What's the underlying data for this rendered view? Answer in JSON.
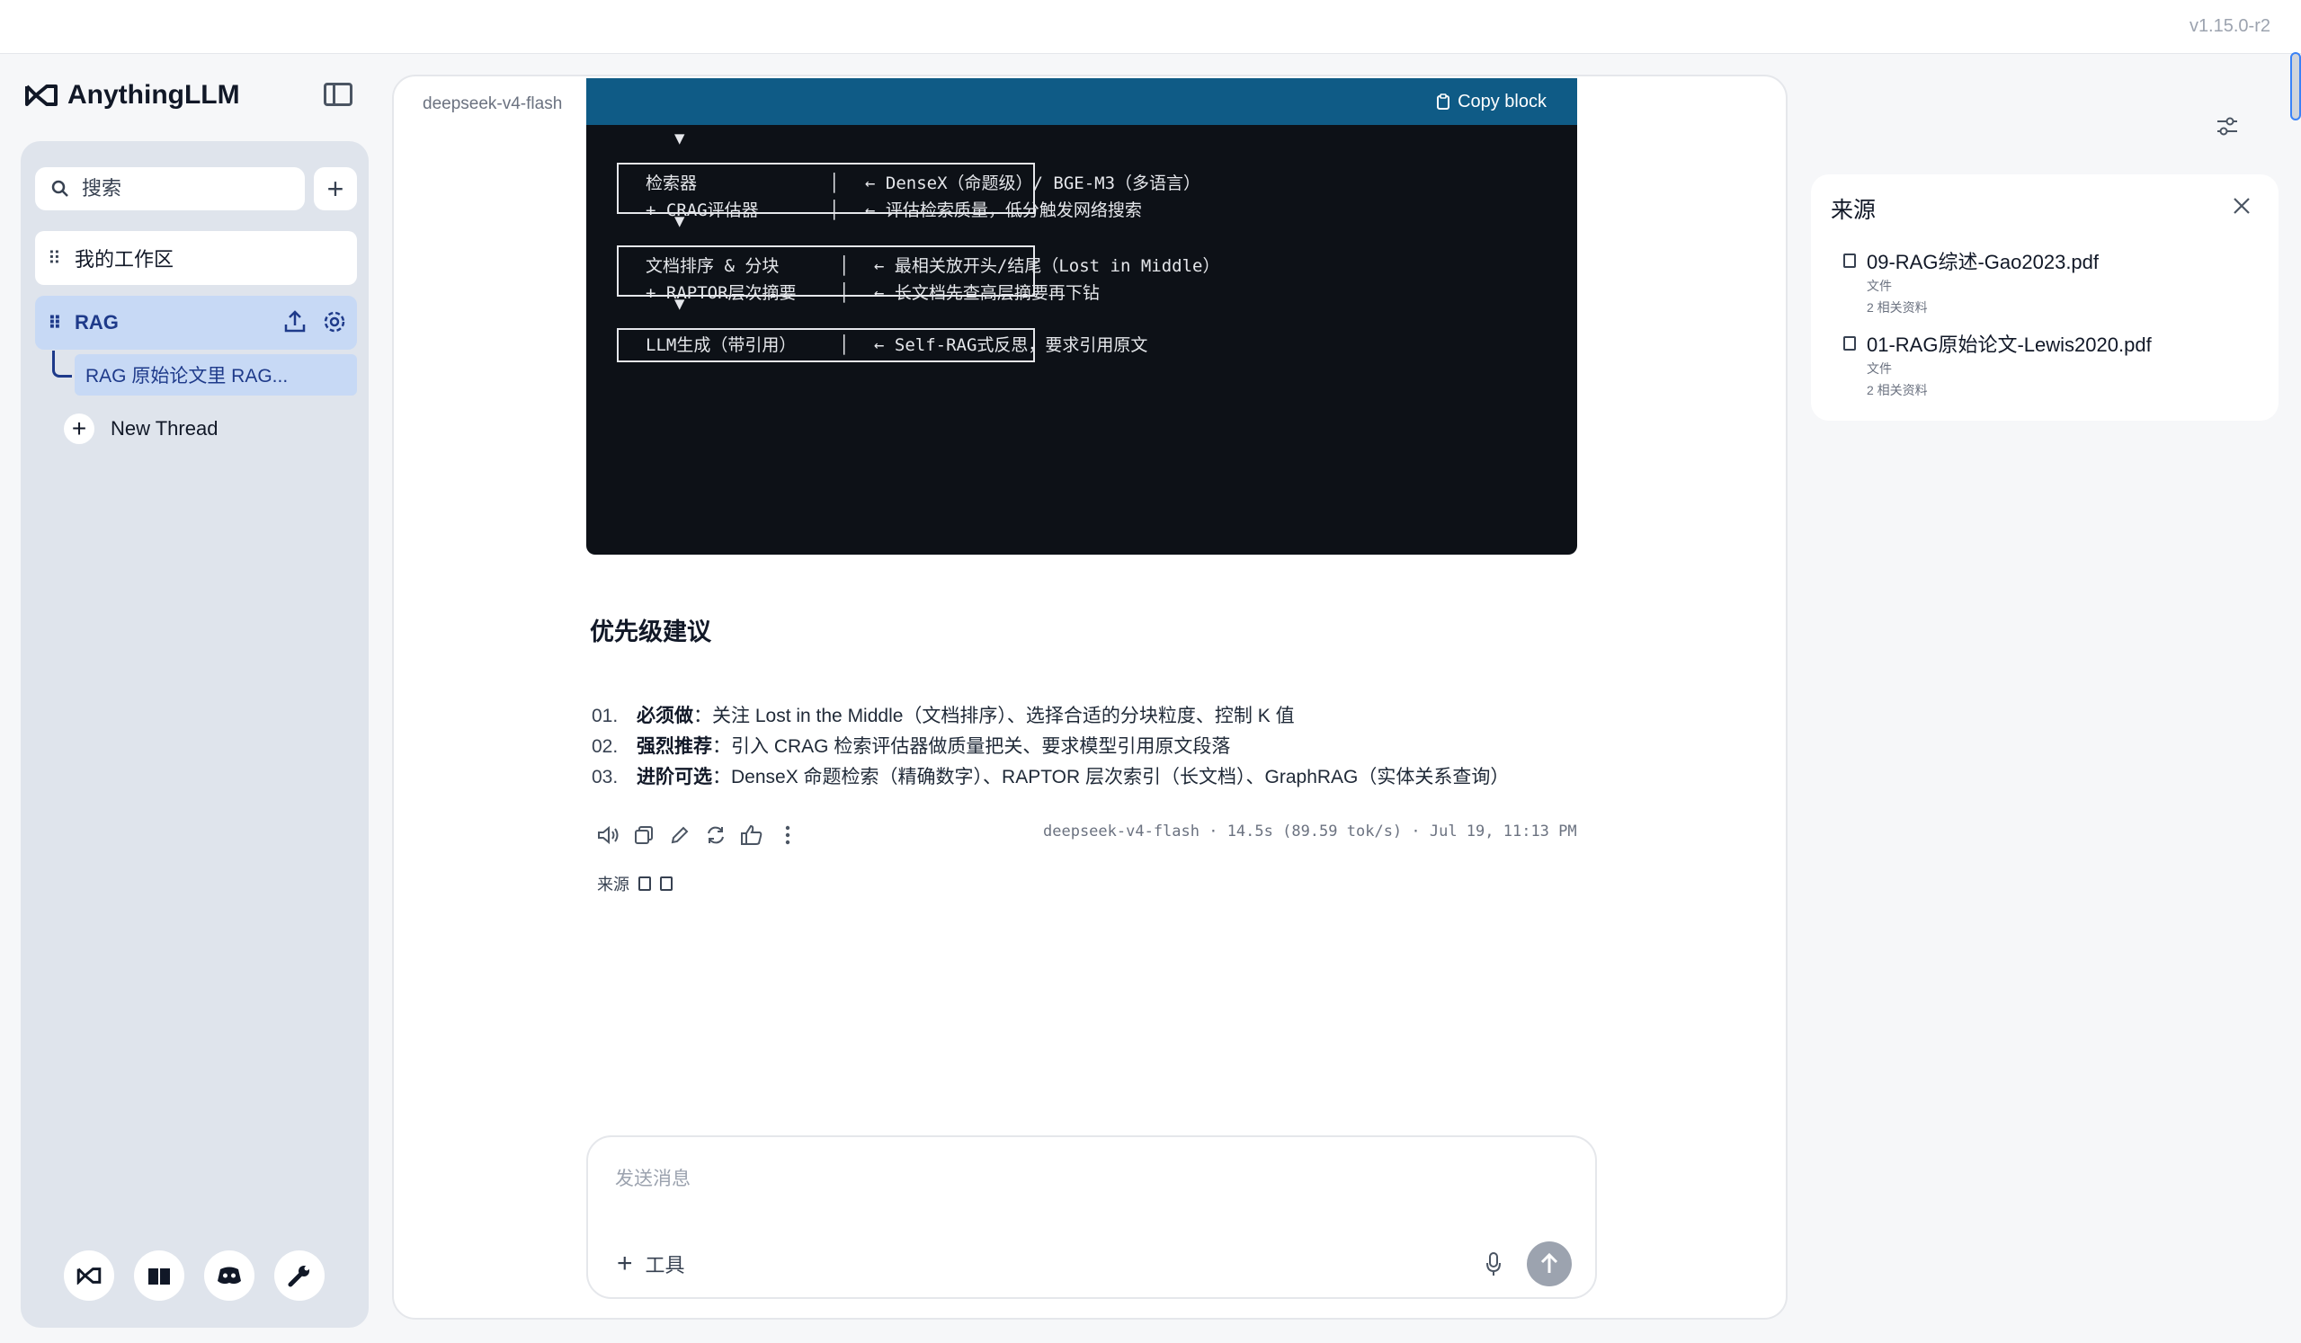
{
  "app": {
    "version": "v1.15.0-r2",
    "brand": "AnythingLLM"
  },
  "sidebar": {
    "search_placeholder": "搜索",
    "workspaces": [
      {
        "label": "我的工作区"
      },
      {
        "label": "RAG"
      }
    ],
    "thread": {
      "label": "RAG 原始论文里 RAG..."
    },
    "new_thread_label": "New Thread"
  },
  "chat": {
    "model_label": "deepseek-v4-flash",
    "code_block": {
      "copy_label": "Copy block",
      "lines": {
        "arrow": "▼",
        "b1_l1": "检索器",
        "b1_l2": "+ CRAG评估器",
        "b1_n1": "← DenseX（命题级）/ BGE-M3（多语言）",
        "b1_n2": "← 评估检索质量，低分触发网络搜索",
        "b2_l1": "文档排序 & 分块",
        "b2_l2": "+ RAPTOR层次摘要",
        "b2_n1": "← 最相关放开头/结尾（Lost in Middle）",
        "b2_n2": "← 长文档先查高层摘要再下钻",
        "b3_l1": "LLM生成（带引用）",
        "b3_n1": "← Self-RAG式反思，要求引用原文",
        "sep": "│"
      }
    },
    "section_title": "优先级建议",
    "priorities": [
      {
        "num": "01.",
        "label": "必须做",
        "text": "：关注 Lost in the Middle（文档排序）、选择合适的分块粒度、控制 K 值"
      },
      {
        "num": "02.",
        "label": "强烈推荐",
        "text": "：引入 CRAG 检索评估器做质量把关、要求模型引用原文段落"
      },
      {
        "num": "03.",
        "label": "进阶可选",
        "text": "：DenseX 命题检索（精确数字）、RAPTOR 层次索引（长文档）、GraphRAG（实体关系查询）"
      }
    ],
    "meta": "deepseek-v4-flash · 14.5s (89.59 tok/s) · Jul 19, 11:13 PM",
    "sources_label": "来源",
    "composer_placeholder": "发送消息",
    "tools_label": "工具"
  },
  "sources_panel": {
    "title": "来源",
    "items": [
      {
        "name": "09-RAG综述-Gao2023.pdf",
        "type": "文件",
        "refs": "2 相关资料"
      },
      {
        "name": "01-RAG原始论文-Lewis2020.pdf",
        "type": "文件",
        "refs": "2 相关资料"
      }
    ]
  }
}
